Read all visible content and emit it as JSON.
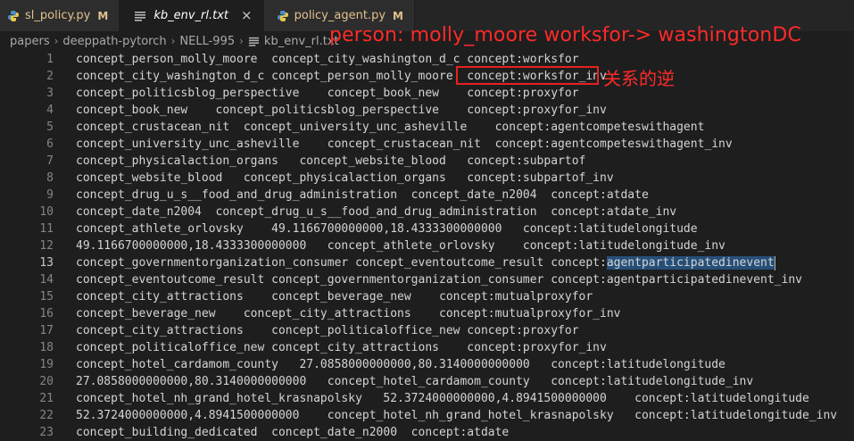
{
  "tabs": [
    {
      "label": "sl_policy.py",
      "badge": "M",
      "icon": "python-icon",
      "active": false
    },
    {
      "label": "kb_env_rl.txt",
      "close": "×",
      "icon": "text-file-icon",
      "active": true
    },
    {
      "label": "policy_agent.py",
      "badge": "M",
      "icon": "python-icon",
      "active": false
    }
  ],
  "breadcrumb": [
    "papers",
    "deeppath-pytorch",
    "NELL-995",
    "kb_env_rl.txt"
  ],
  "annotations": {
    "top": "person: molly_moore worksfor-> washingtonDC",
    "right": "关系的逆"
  },
  "lines": [
    {
      "n": "1",
      "a": "concept_person_molly_moore  concept_city_washington_d_c concept:worksfor"
    },
    {
      "n": "2",
      "a": "concept_city_washington_d_c concept_person_molly_moore  concept:worksfor_inv"
    },
    {
      "n": "3",
      "a": "concept_politicsblog_perspective    concept_book_new    concept:proxyfor"
    },
    {
      "n": "4",
      "a": "concept_book_new    concept_politicsblog_perspective    concept:proxyfor_inv"
    },
    {
      "n": "5",
      "a": "concept_crustacean_nit  concept_university_unc_asheville    concept:agentcompeteswithagent"
    },
    {
      "n": "6",
      "a": "concept_university_unc_asheville    concept_crustacean_nit  concept:agentcompeteswithagent_inv"
    },
    {
      "n": "7",
      "a": "concept_physicalaction_organs   concept_website_blood   concept:subpartof"
    },
    {
      "n": "8",
      "a": "concept_website_blood   concept_physicalaction_organs   concept:subpartof_inv"
    },
    {
      "n": "9",
      "a": "concept_drug_u_s__food_and_drug_administration  concept_date_n2004  concept:atdate"
    },
    {
      "n": "10",
      "a": "concept_date_n2004  concept_drug_u_s__food_and_drug_administration  concept:atdate_inv"
    },
    {
      "n": "11",
      "a": "concept_athlete_orlovsky    49.1166700000000,18.4333300000000   concept:latitudelongitude"
    },
    {
      "n": "12",
      "a": "49.1166700000000,18.4333300000000   concept_athlete_orlovsky    concept:latitudelongitude_inv"
    },
    {
      "n": "13",
      "a": "concept_governmentorganization_consumer concept_eventoutcome_result concept:",
      "sel": "agentparticipatedinevent",
      "current": true
    },
    {
      "n": "14",
      "a": "concept_eventoutcome_result concept_governmentorganization_consumer concept:agentparticipatedinevent_inv"
    },
    {
      "n": "15",
      "a": "concept_city_attractions    concept_beverage_new    concept:mutualproxyfor"
    },
    {
      "n": "16",
      "a": "concept_beverage_new    concept_city_attractions    concept:mutualproxyfor_inv"
    },
    {
      "n": "17",
      "a": "concept_city_attractions    concept_politicaloffice_new concept:proxyfor"
    },
    {
      "n": "18",
      "a": "concept_politicaloffice_new concept_city_attractions    concept:proxyfor_inv"
    },
    {
      "n": "19",
      "a": "concept_hotel_cardamom_county   27.0858000000000,80.3140000000000   concept:latitudelongitude"
    },
    {
      "n": "20",
      "a": "27.0858000000000,80.3140000000000   concept_hotel_cardamom_county   concept:latitudelongitude_inv"
    },
    {
      "n": "21",
      "a": "concept_hotel_nh_grand_hotel_krasnapolsky   52.3724000000000,4.8941500000000    concept:latitudelongitude"
    },
    {
      "n": "22",
      "a": "52.3724000000000,4.8941500000000    concept_hotel_nh_grand_hotel_krasnapolsky   concept:latitudelongitude_inv"
    },
    {
      "n": "23",
      "a": "concept_building_dedicated  concept_date_n2000  concept:atdate"
    }
  ]
}
